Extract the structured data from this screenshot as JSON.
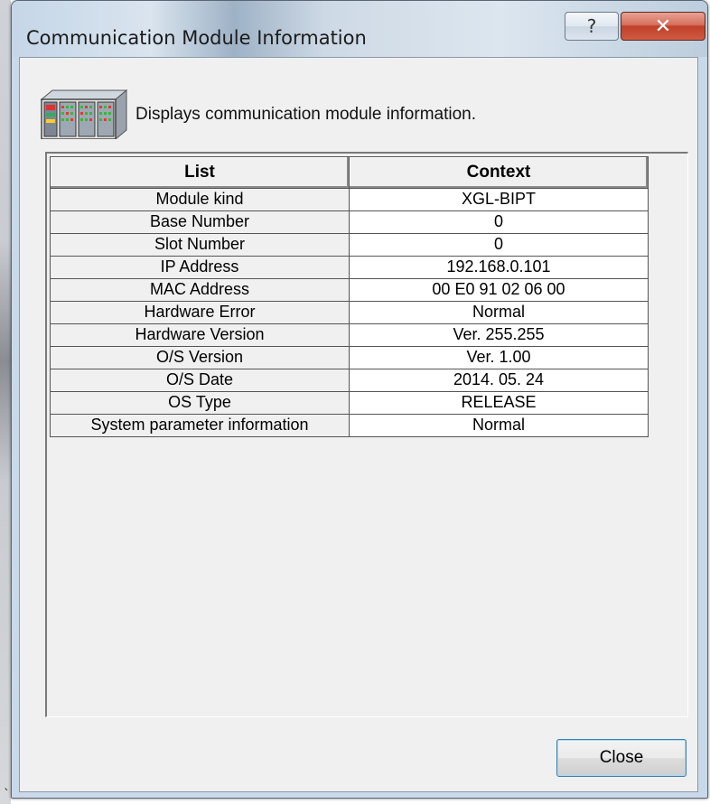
{
  "window": {
    "title": "Communication Module Information",
    "help_icon": "help-icon",
    "close_icon": "close-icon"
  },
  "header": {
    "icon": "module-rack-icon",
    "description": "Displays communication module information."
  },
  "table": {
    "columns": [
      "List",
      "Context"
    ],
    "rows": [
      {
        "item": "Module kind",
        "value": "XGL-BIPT"
      },
      {
        "item": "Base Number",
        "value": "0"
      },
      {
        "item": "Slot Number",
        "value": "0"
      },
      {
        "item": "IP Address",
        "value": "192.168.0.101"
      },
      {
        "item": "MAC Address",
        "value": "00 E0 91 02 06 00"
      },
      {
        "item": "Hardware Error",
        "value": "Normal"
      },
      {
        "item": "Hardware Version",
        "value": "Ver. 255.255"
      },
      {
        "item": "O/S Version",
        "value": "Ver. 1.00"
      },
      {
        "item": "O/S Date",
        "value": "2014. 05. 24"
      },
      {
        "item": "OS Type",
        "value": "RELEASE"
      },
      {
        "item": "System parameter information",
        "value": "Normal"
      }
    ]
  },
  "footer": {
    "close_label": "Close"
  },
  "stray_char": "`",
  "colors": {
    "titlebar": "#c9d9ea",
    "client": "#f0f0f0",
    "close_x": "#c1402a",
    "button_focus": "#3c7fb1"
  }
}
